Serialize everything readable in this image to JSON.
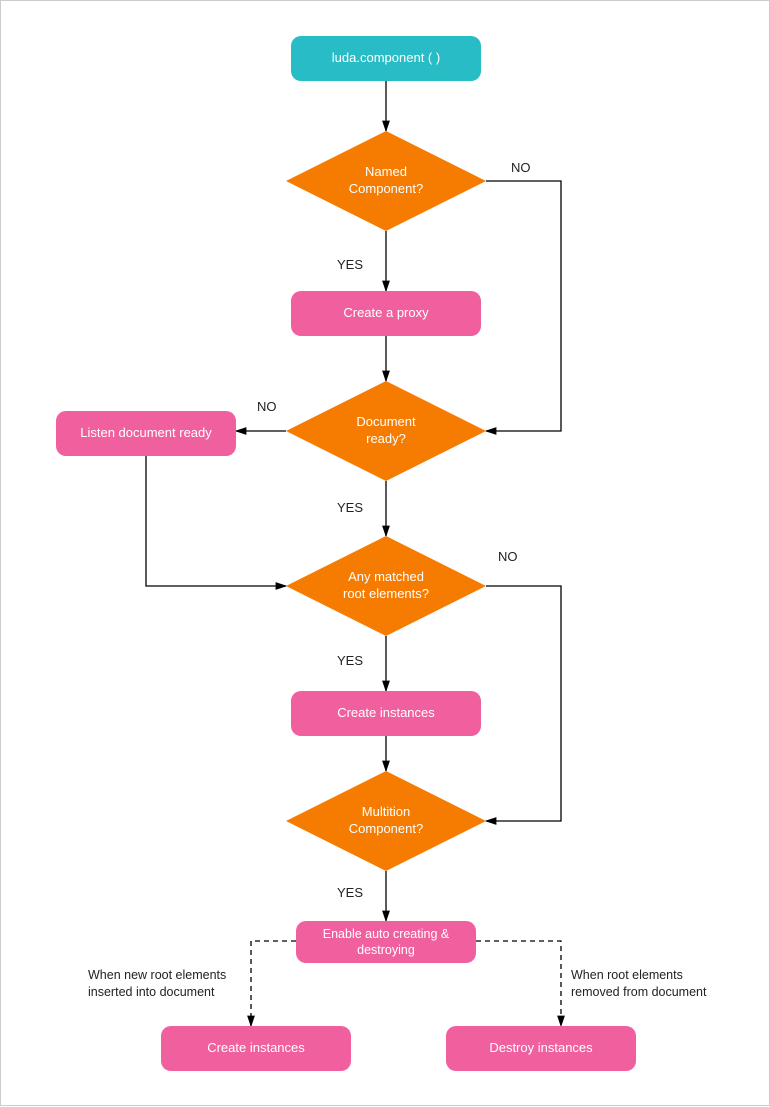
{
  "nodes": {
    "start": {
      "label": "luda.component ( )"
    },
    "d_named": {
      "label": "Named\nComponent?"
    },
    "p_proxy": {
      "label": "Create a proxy"
    },
    "d_docrdy": {
      "label": "Document\nready?"
    },
    "p_listen": {
      "label": "Listen document ready"
    },
    "d_match": {
      "label": "Any matched\nroot elements?"
    },
    "p_create1": {
      "label": "Create instances"
    },
    "d_multi": {
      "label": "Multition\nComponent?"
    },
    "p_auto": {
      "label": "Enable auto creating &\ndestroying"
    },
    "p_create2": {
      "label": "Create instances"
    },
    "p_destroy": {
      "label": "Destroy instances"
    }
  },
  "labels": {
    "named_yes": "YES",
    "named_no": "NO",
    "docrdy_yes": "YES",
    "docrdy_no": "NO",
    "match_yes": "YES",
    "match_no": "NO",
    "multi_yes": "YES",
    "insert_note": "When new root elements\ninserted into document",
    "remove_note": "When root elements\nremoved from document"
  }
}
